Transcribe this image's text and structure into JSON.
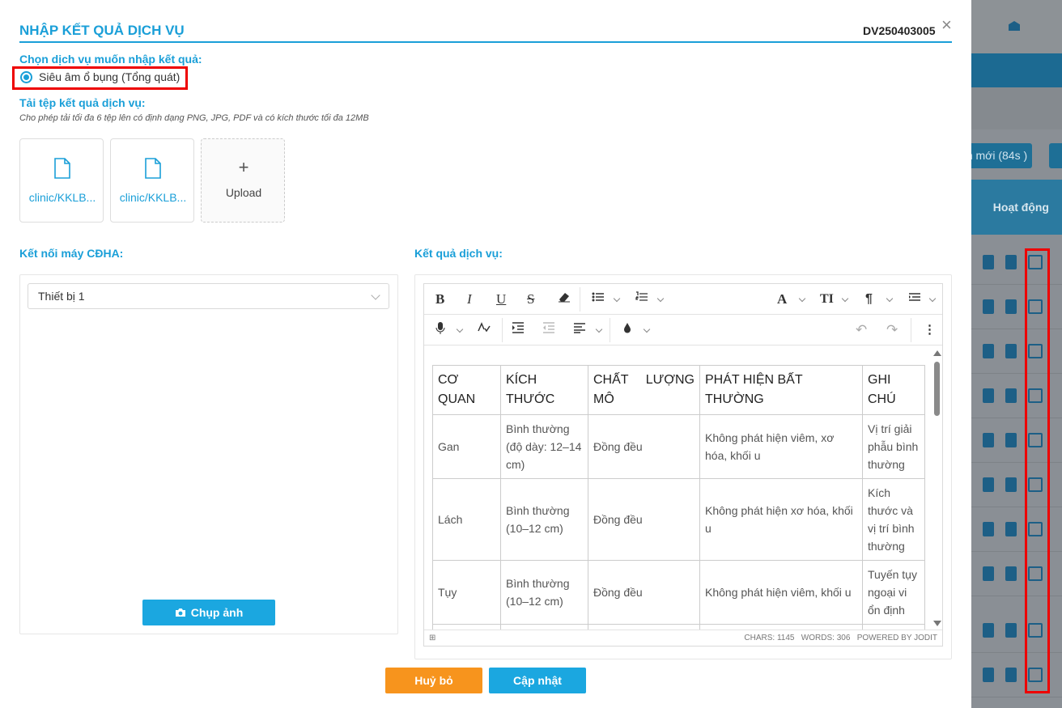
{
  "modal": {
    "title": "NHẬP KẾT QUẢ DỊCH VỤ",
    "code": "DV250403005",
    "close_glyph": "×",
    "choose_label": "Chọn dịch vụ muốn nhập kết quả:",
    "service_option": "Siêu âm ổ bụng (Tổng quát)",
    "upload_label": "Tải tệp kết quả dịch vụ:",
    "upload_hint": "Cho phép tải tối đa 6 tệp lên có định dạng PNG, JPG, PDF và có kích thước tối đa 12MB",
    "files": [
      {
        "name": "clinic/KKLB..."
      },
      {
        "name": "clinic/KKLB..."
      }
    ],
    "upload_plus": "+",
    "upload_button": "Upload",
    "device_label": "Kết nối máy CĐHA:",
    "device_selected": "Thiết bị 1",
    "capture_button": "Chụp ảnh",
    "result_label": "Kết quả dịch vụ:",
    "cancel_button": "Huỷ bỏ",
    "update_button": "Cập nhật"
  },
  "editor": {
    "toolbar_glyphs": {
      "bold": "B",
      "italic": "I",
      "underline": "U",
      "strike": "S",
      "font": "A",
      "size": "TI",
      "paragraph": "¶",
      "more": "⋮",
      "undo": "↶",
      "redo": "↷"
    },
    "table_headers": [
      "CƠ QUAN",
      "KÍCH THƯỚC",
      "CHẤT LƯỢNG MÔ",
      "PHÁT HIỆN BẤT THƯỜNG",
      "GHI CHÚ"
    ],
    "rows": [
      [
        "Gan",
        "Bình thường (độ dày: 12–14 cm)",
        "Đồng đều",
        "Không phát hiện viêm, xơ hóa, khối u",
        "Vị trí giải phẫu bình thường"
      ],
      [
        "Lách",
        "Bình thường (10–12 cm)",
        "Đồng đều",
        "Không phát hiện xơ hóa, khối u",
        "Kích thước và vị trí bình thường"
      ],
      [
        "Tụy",
        "Bình thường (10–12 cm)",
        "Đồng đều",
        "Không phát hiện viêm, khối u",
        "Tuyến tụy ngoại vi ổn định"
      ]
    ],
    "status": "CHARS: 1145   WORDS: 306   POWERED BY JODIT"
  },
  "background": {
    "refresh_pill": "n mới (84s )",
    "column_header": "Hoạt động"
  },
  "colors": {
    "accent": "#1a9fd8",
    "cancel": "#f7941d",
    "highlight": "#e00000"
  }
}
